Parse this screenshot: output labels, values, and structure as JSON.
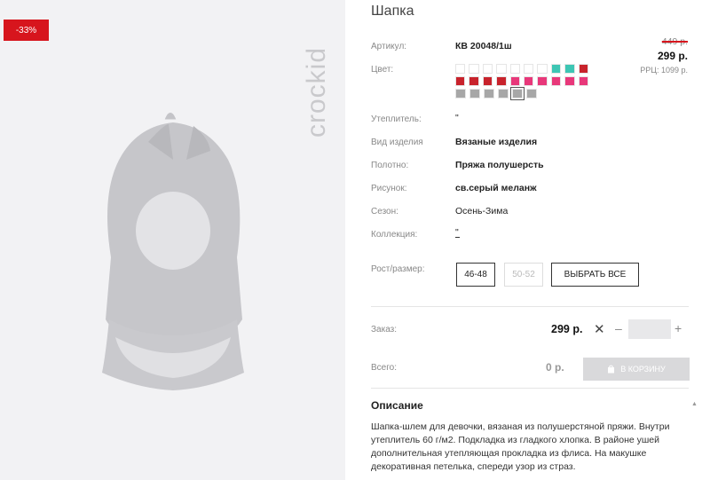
{
  "badge": {
    "discount": "-33%"
  },
  "brand": {
    "logo_text": "crockid"
  },
  "product": {
    "title": "Шапка",
    "article_label": "Артикул:",
    "article_value": "КВ 20048/1ш",
    "color_label": "Цвет:",
    "insulation_label": "Утеплитель:",
    "insulation_value": "\"",
    "type_label": "Вид изделия",
    "type_value": "Вязаные изделия",
    "fabric_label": "Полотно:",
    "fabric_value": "Пряжа полушерсть",
    "pattern_label": "Рисунок:",
    "pattern_value": "св.серый меланж",
    "season_label": "Сезон:",
    "season_value": "Осень-Зима",
    "collection_label": "Коллекция:",
    "collection_value": "\"",
    "size_label": "Рост/размер:"
  },
  "price": {
    "old": "449 р.",
    "current": "299 р.",
    "rrc": "РРЦ: 1099 р."
  },
  "swatches": {
    "rows": [
      [
        "#ffffff",
        "#ffffff",
        "#ffffff",
        "#ffffff",
        "#ffffff",
        "#ffffff",
        "#ffffff",
        "#3dc6b4",
        "#3dc6b4",
        "#c8232c"
      ],
      [
        "#c8232c",
        "#c8232c",
        "#c8232c",
        "#c8232c",
        "#e8387a",
        "#e8387a",
        "#e8387a",
        "#e8387a",
        "#e8387a",
        "#e8387a"
      ],
      [
        "#a7a7a7",
        "#a7a7a7",
        "#a7a7a7",
        "#a7a7a7",
        "#a7a7a7",
        "#a7a7a7"
      ]
    ],
    "selected_row": 2,
    "selected_index": 4
  },
  "sizes": {
    "options": [
      {
        "label": "46-48",
        "enabled": true
      },
      {
        "label": "50-52",
        "enabled": false
      }
    ],
    "select_all": "ВЫБРАТЬ ВСЕ"
  },
  "order": {
    "label": "Заказ:",
    "price": "299 р.",
    "times": "✕",
    "minus": "–",
    "plus": "+",
    "quantity": ""
  },
  "total": {
    "label": "Всего:",
    "value": "0 р.",
    "cart_button": "В КОРЗИНУ"
  },
  "description": {
    "title": "Описание",
    "caret": "▲",
    "text": "Шапка-шлем для девочки, вязаная из полушерстяной пряжи. Внутри утеплитель 60 г/м2. Подкладка из гладкого хлопка. В районе ушей дополнительная утепляющая прокладка из флиса. На макушке декоративная петелька, спереди узор из страз."
  },
  "colors": {
    "accent": "#d7151d",
    "panel_bg": "#f2f2f4",
    "button_disabled": "#d9d9db"
  }
}
